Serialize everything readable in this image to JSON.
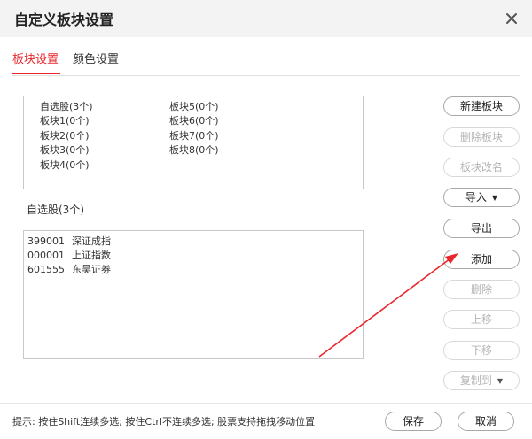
{
  "window": {
    "title": "自定义板块设置"
  },
  "tabs": [
    {
      "label": "板块设置",
      "active": true
    },
    {
      "label": "颜色设置",
      "active": false
    }
  ],
  "block_list": {
    "left_column": [
      "自选股(3个)",
      "板块1(0个)",
      "板块2(0个)",
      "板块3(0个)",
      "板块4(0个)"
    ],
    "right_column": [
      "板块5(0个)",
      "板块6(0个)",
      "板块7(0个)",
      "板块8(0个)"
    ]
  },
  "selected_block_label": "自选股(3个)",
  "stocks": [
    {
      "code": "399001",
      "name": "深证成指"
    },
    {
      "code": "000001",
      "name": "上证指数"
    },
    {
      "code": "601555",
      "name": "东吴证券"
    }
  ],
  "buttons": {
    "new_block": "新建板块",
    "delete_block": "删除板块",
    "rename_block": "板块改名",
    "import": "导入",
    "export": "导出",
    "add": "添加",
    "delete": "删除",
    "move_up": "上移",
    "move_down": "下移",
    "copy_to": "复制到"
  },
  "footer": {
    "hint": "提示: 按住Shift连续多选; 按住Ctrl不连续多选; 股票支持拖拽移动位置",
    "save": "保存",
    "cancel": "取消"
  },
  "colors": {
    "accent": "#e8262c",
    "annotation_arrow": "#e8262c"
  },
  "icons": {
    "close": "close-icon",
    "dropdown": "caret-down-icon"
  }
}
